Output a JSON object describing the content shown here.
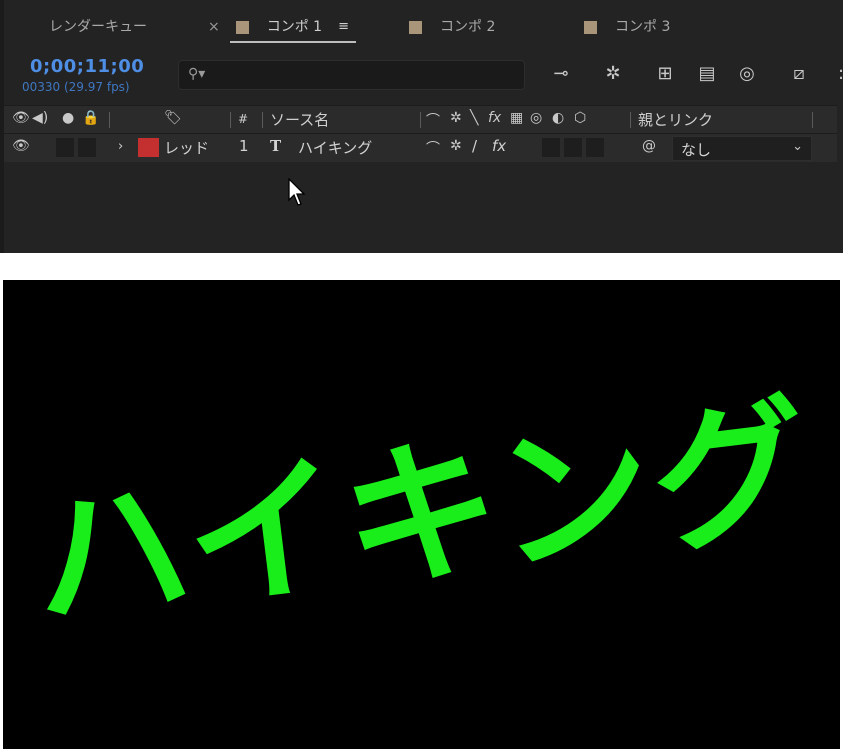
{
  "tabs": [
    {
      "label": "レンダーキュー",
      "active": false
    },
    {
      "label": "コンポ 1",
      "active": true,
      "close": "×",
      "menu": "≡",
      "swatch": "#a8957a"
    },
    {
      "label": "コンポ 2",
      "active": false,
      "swatch": "#a8957a"
    },
    {
      "label": "コンポ 3",
      "active": false,
      "swatch": "#a8957a"
    }
  ],
  "timeline": {
    "timecode": "0;00;11;00",
    "frame_fps": "00330 (29.97 fps)",
    "search_placeholder": ""
  },
  "columns": {
    "hash": "#",
    "source_name": "ソース名",
    "parent_link": "親とリンク"
  },
  "layer": {
    "label": "レッド",
    "label_color": "#c3302f",
    "index": "1",
    "type_glyph": "T",
    "name": "ハイキング",
    "fx": "fx",
    "parent_value": "なし"
  },
  "viewer": {
    "text": "ハイキング",
    "text_color": "#19ee1b",
    "background": "#000000"
  },
  "icons": {
    "toolbar": [
      "draft-3d-icon",
      "shy-layers-icon",
      "frame-blending-icon",
      "motion-blur-icon",
      "graph-editor-icon",
      "composition-settings-icon"
    ]
  }
}
